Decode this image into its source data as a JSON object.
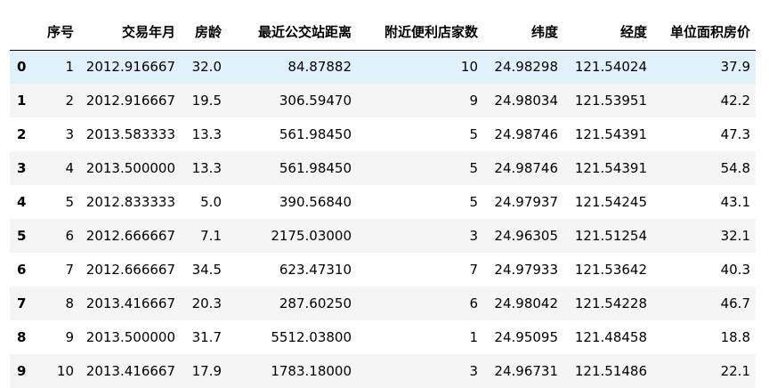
{
  "table": {
    "columns": [
      "序号",
      "交易年月",
      "房龄",
      "最近公交站距离",
      "附近便利店家数",
      "纬度",
      "经度",
      "单位面积房价"
    ],
    "index": [
      "0",
      "1",
      "2",
      "3",
      "4",
      "5",
      "6",
      "7",
      "8",
      "9"
    ],
    "rows": [
      [
        "1",
        "2012.916667",
        "32.0",
        "84.87882",
        "10",
        "24.98298",
        "121.54024",
        "37.9"
      ],
      [
        "2",
        "2012.916667",
        "19.5",
        "306.59470",
        "9",
        "24.98034",
        "121.53951",
        "42.2"
      ],
      [
        "3",
        "2013.583333",
        "13.3",
        "561.98450",
        "5",
        "24.98746",
        "121.54391",
        "47.3"
      ],
      [
        "4",
        "2013.500000",
        "13.3",
        "561.98450",
        "5",
        "24.98746",
        "121.54391",
        "54.8"
      ],
      [
        "5",
        "2012.833333",
        "5.0",
        "390.56840",
        "5",
        "24.97937",
        "121.54245",
        "43.1"
      ],
      [
        "6",
        "2012.666667",
        "7.1",
        "2175.03000",
        "3",
        "24.96305",
        "121.51254",
        "32.1"
      ],
      [
        "7",
        "2012.666667",
        "34.5",
        "623.47310",
        "7",
        "24.97933",
        "121.53642",
        "40.3"
      ],
      [
        "8",
        "2013.416667",
        "20.3",
        "287.60250",
        "6",
        "24.98042",
        "121.54228",
        "46.7"
      ],
      [
        "9",
        "2013.500000",
        "31.7",
        "5512.03800",
        "1",
        "24.95095",
        "121.48458",
        "18.8"
      ],
      [
        "10",
        "2013.416667",
        "17.9",
        "1783.18000",
        "3",
        "24.96731",
        "121.51486",
        "22.1"
      ]
    ],
    "highlighted_row": 0
  },
  "colors": {
    "highlight_row": "#e1f1fb",
    "striped_row": "#f5f5f5",
    "header_border": "#000000",
    "text": "#000000"
  }
}
